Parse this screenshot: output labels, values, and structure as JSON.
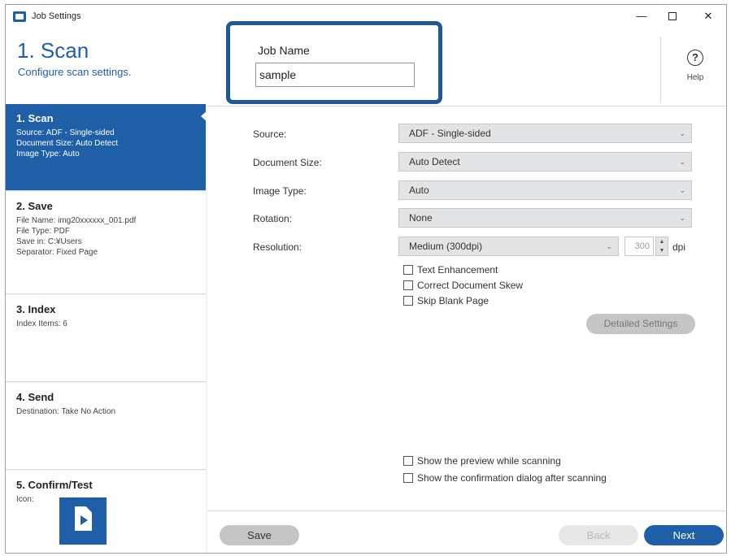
{
  "window": {
    "title": "Job Settings",
    "controls": {
      "minimize": "—",
      "close": "✕"
    }
  },
  "header": {
    "step_title": "1. Scan",
    "step_subtitle": "Configure scan settings.",
    "help_icon": "?",
    "help_label": "Help"
  },
  "job_name": {
    "label": "Job Name",
    "value": "sample"
  },
  "sidebar": {
    "items": [
      {
        "title": "1. Scan",
        "lines": [
          "Source: ADF - Single-sided",
          "Document Size: Auto Detect",
          "Image Type: Auto"
        ],
        "active": true
      },
      {
        "title": "2. Save",
        "lines": [
          "File Name: img20xxxxxx_001.pdf",
          "File Type: PDF",
          "Save in: C:¥Users",
          "Separator: Fixed Page"
        ],
        "active": false
      },
      {
        "title": "3. Index",
        "lines": [
          "Index Items: 6"
        ],
        "active": false
      },
      {
        "title": "4. Send",
        "lines": [
          "Destination: Take No Action"
        ],
        "active": false
      },
      {
        "title": "5. Confirm/Test",
        "lines": [
          "Icon:"
        ],
        "active": false
      }
    ]
  },
  "form": {
    "source": {
      "label": "Source:",
      "value": "ADF - Single-sided"
    },
    "document_size": {
      "label": "Document Size:",
      "value": "Auto Detect"
    },
    "image_type": {
      "label": "Image Type:",
      "value": "Auto"
    },
    "rotation": {
      "label": "Rotation:",
      "value": "None"
    },
    "resolution": {
      "label": "Resolution:",
      "value": "Medium (300dpi)",
      "custom_value": "300",
      "unit": "dpi"
    },
    "checkboxes": {
      "text_enhancement": "Text Enhancement",
      "correct_skew": "Correct Document Skew",
      "skip_blank": "Skip Blank Page"
    },
    "detailed_settings": "Detailed Settings",
    "show_preview": "Show the preview while scanning",
    "show_confirmation": "Show the confirmation dialog after scanning",
    "chevron": "⌄"
  },
  "footer": {
    "save": "Save",
    "back": "Back",
    "next": "Next"
  }
}
